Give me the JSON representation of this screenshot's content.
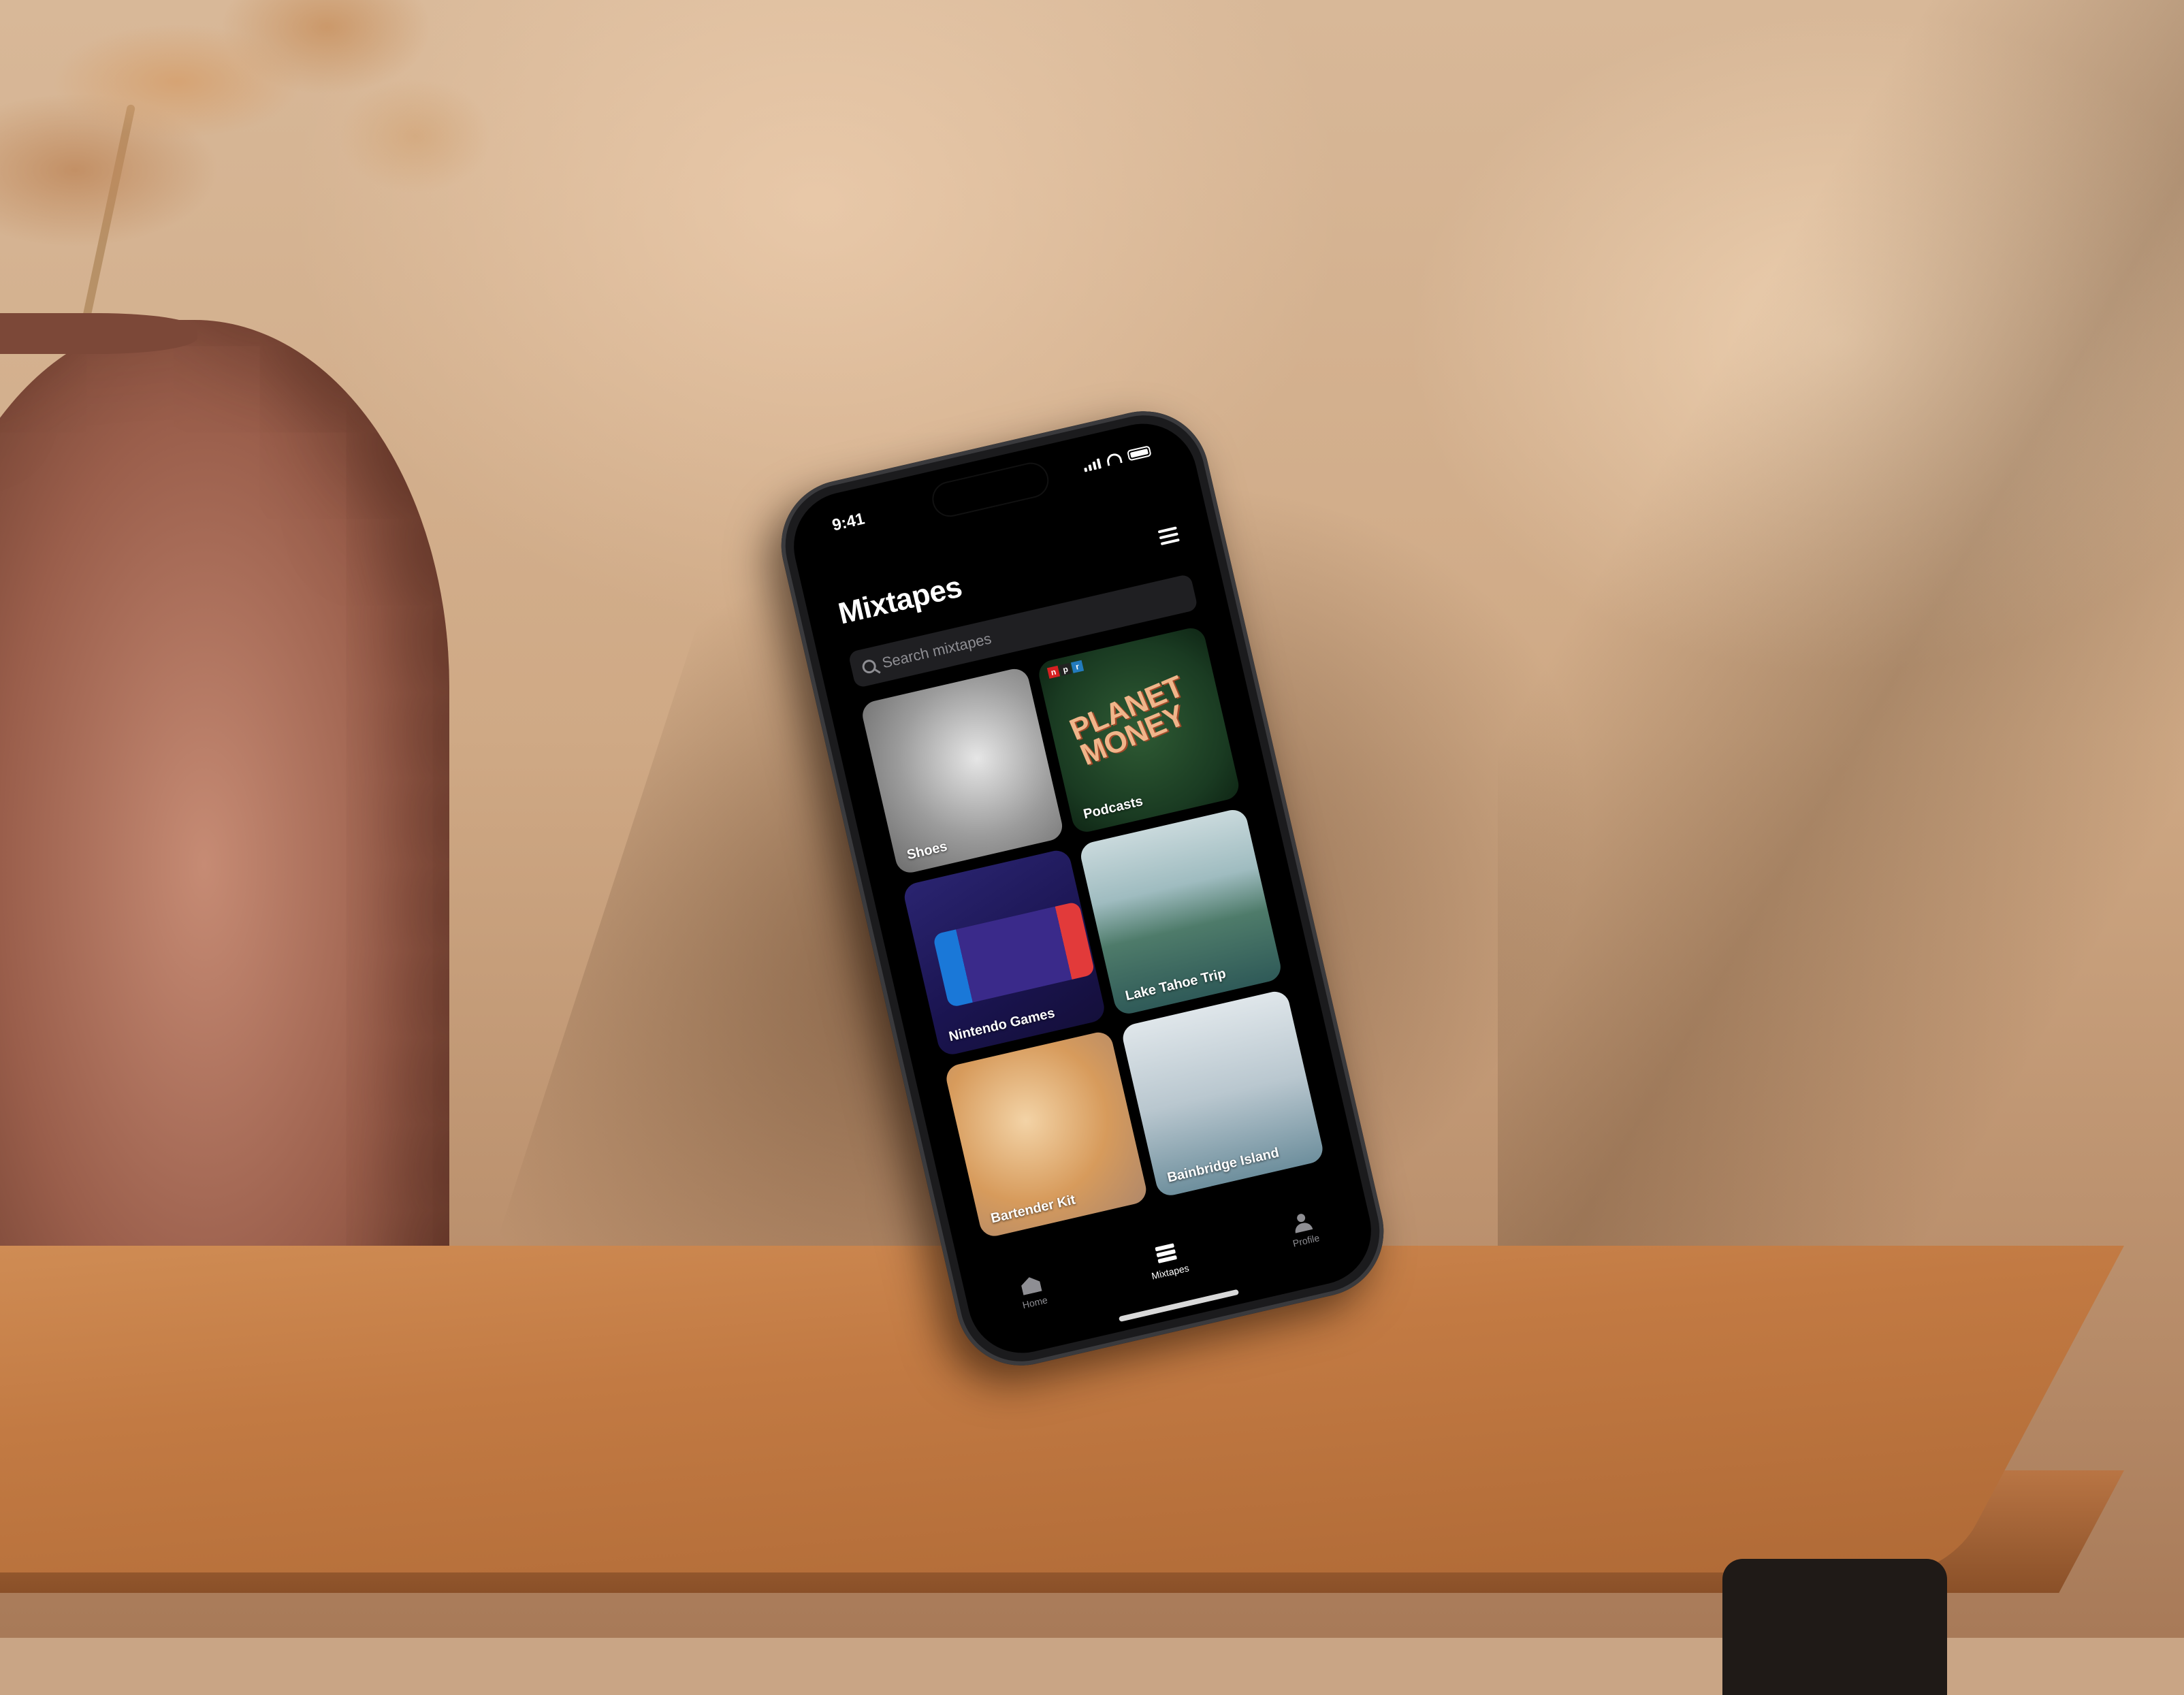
{
  "status_bar": {
    "time": "9:41"
  },
  "header": {
    "title": "Mixtapes"
  },
  "search": {
    "placeholder": "Search mixtapes"
  },
  "mixtapes": [
    {
      "label": "Shoes",
      "image": "sneaker-photo"
    },
    {
      "label": "Podcasts",
      "image": "planet-money-cover",
      "cover_text": "PLANET MONEY",
      "logo": [
        "n",
        "p",
        "r"
      ]
    },
    {
      "label": "Nintendo Games",
      "image": "nintendo-switch-photo"
    },
    {
      "label": "Lake Tahoe Trip",
      "image": "lake-photo"
    },
    {
      "label": "Bartender Kit",
      "image": "cocktails-photo"
    },
    {
      "label": "Bainbridge Island",
      "image": "ferry-photo"
    }
  ],
  "tab_bar": {
    "tabs": [
      {
        "label": "Home",
        "icon": "home-icon",
        "active": false
      },
      {
        "label": "Mixtapes",
        "icon": "mixtapes-icon",
        "active": true
      },
      {
        "label": "Profile",
        "icon": "profile-icon",
        "active": false
      }
    ]
  },
  "colors": {
    "background": "#000000",
    "search_field": "#1f1f22",
    "inactive_tab": "#8e8e93",
    "planet_money_accent": "#f0b58a"
  }
}
